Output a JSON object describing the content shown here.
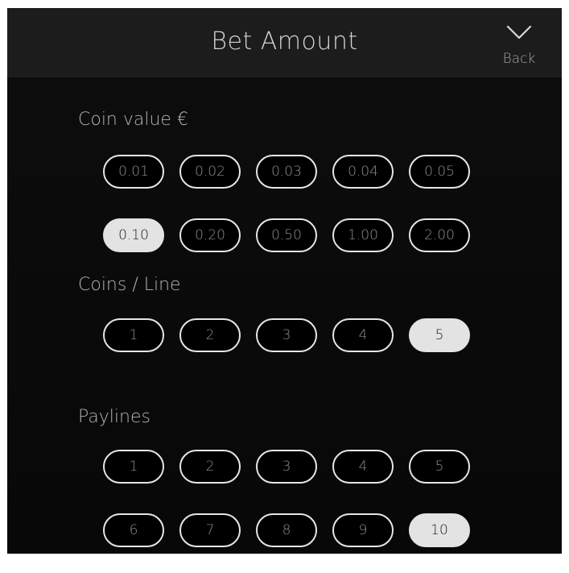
{
  "header": {
    "title": "Bet Amount",
    "back_label": "Back",
    "back_icon": "chevron-down-icon"
  },
  "sections": {
    "coin_value": {
      "label": "Coin value €",
      "rows": [
        [
          "0.01",
          "0.02",
          "0.03",
          "0.04",
          "0.05"
        ],
        [
          "0.10",
          "0.20",
          "0.50",
          "1.00",
          "2.00"
        ]
      ],
      "selected": "0.10"
    },
    "coins_per_line": {
      "label": "Coins / Line",
      "rows": [
        [
          "1",
          "2",
          "3",
          "4",
          "5"
        ]
      ],
      "selected": "5"
    },
    "paylines": {
      "label": "Paylines",
      "rows": [
        [
          "1",
          "2",
          "3",
          "4",
          "5"
        ],
        [
          "6",
          "7",
          "8",
          "9",
          "10"
        ]
      ],
      "selected": "10"
    }
  },
  "colors": {
    "background": "#0a0a0a",
    "header": "#1c1c1c",
    "pill_border": "#e6e6e6",
    "pill_selected": "#e3e3e3"
  }
}
